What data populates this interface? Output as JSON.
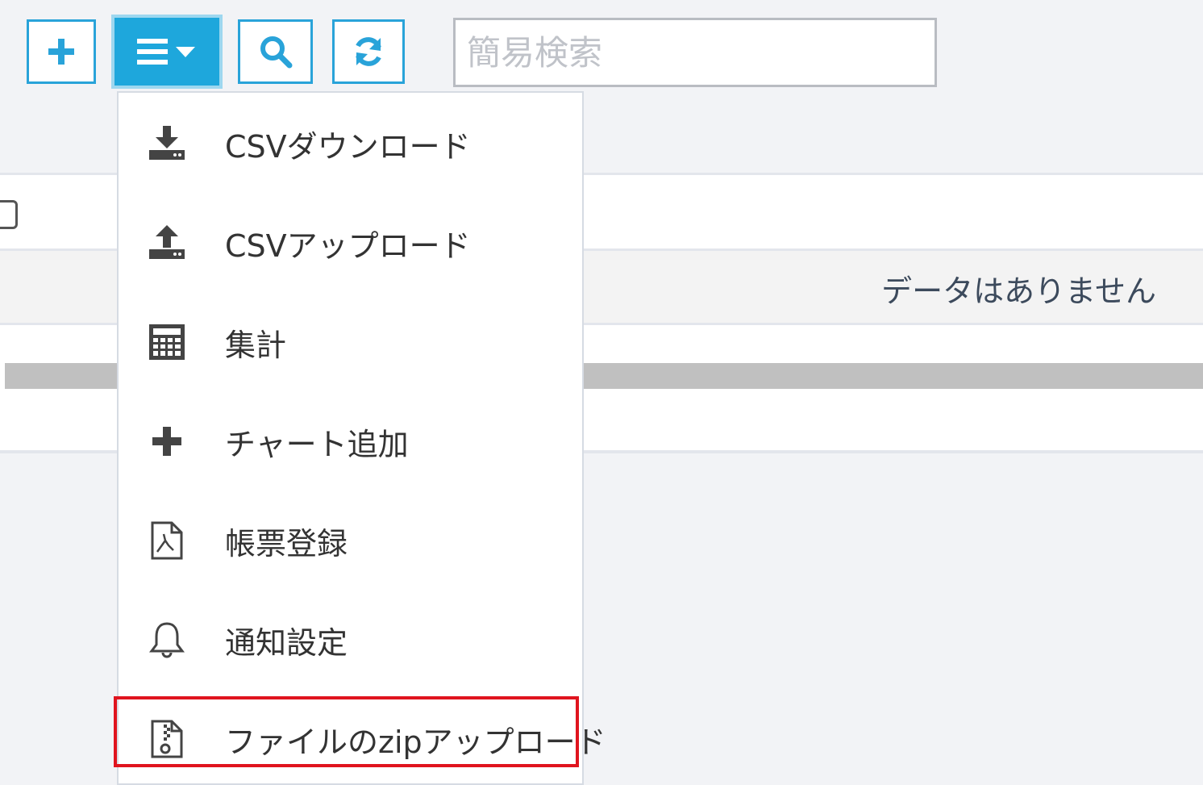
{
  "toolbar": {
    "add_icon": "plus-icon",
    "menu_icon": "bars-caret-icon",
    "search_icon": "search-icon",
    "refresh_icon": "refresh-icon",
    "search_placeholder": "簡易検索"
  },
  "table": {
    "empty_message": "データはありません"
  },
  "menu": {
    "items": [
      {
        "label": "CSVダウンロード",
        "icon": "download-icon"
      },
      {
        "label": "CSVアップロード",
        "icon": "upload-icon"
      },
      {
        "label": "集計",
        "icon": "calculator-icon"
      },
      {
        "label": "チャート追加",
        "icon": "plus-icon"
      },
      {
        "label": "帳票登録",
        "icon": "pdf-file-icon"
      },
      {
        "label": "通知設定",
        "icon": "bell-icon"
      },
      {
        "label": "ファイルのzipアップロード",
        "icon": "zip-file-icon"
      }
    ]
  },
  "colors": {
    "accent": "#1ea7dc",
    "highlight": "#e0141e"
  }
}
